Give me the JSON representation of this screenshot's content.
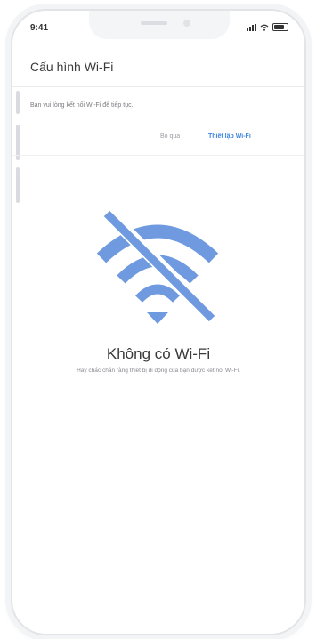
{
  "status_bar": {
    "time": "9:41",
    "signal_icon": "signal-bars-icon",
    "wifi_icon": "wifi-icon",
    "battery_icon": "battery-icon"
  },
  "header": {
    "title": "Cấu hình Wi-Fi"
  },
  "prompt": {
    "message": "Bạn vui lòng kết nối Wi-Fi để tiếp tục.",
    "skip_label": "Bỏ qua",
    "continue_label": "Thiết lập Wi-Fi"
  },
  "empty_state": {
    "icon": "no-wifi-icon",
    "title": "Không có Wi-Fi",
    "description": "Hãy chắc chắn rằng thiết bị di động của bạn được kết nối Wi-Fi."
  },
  "colors": {
    "accent": "#3e86dc",
    "icon_blue": "#6f9adf"
  }
}
